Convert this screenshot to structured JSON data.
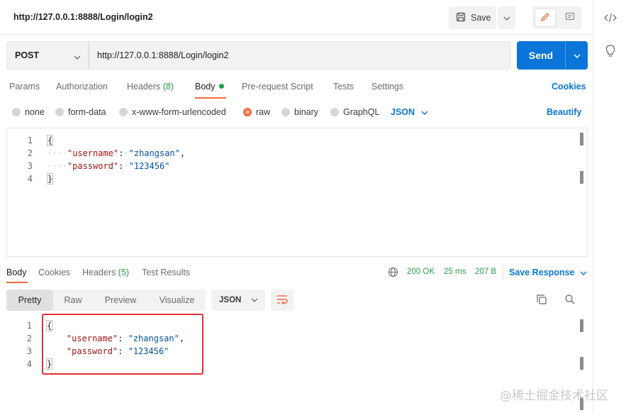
{
  "header": {
    "title": "http://127.0.0.1:8888/Login/login2",
    "save_label": "Save"
  },
  "request": {
    "method": "POST",
    "url": "http://127.0.0.1:8888/Login/login2",
    "send_label": "Send"
  },
  "request_tabs": [
    {
      "label": "Params"
    },
    {
      "label": "Authorization"
    },
    {
      "label": "Headers",
      "count": "(8)"
    },
    {
      "label": "Body"
    },
    {
      "label": "Pre-request Script"
    },
    {
      "label": "Tests"
    },
    {
      "label": "Settings"
    }
  ],
  "cookies_label": "Cookies",
  "body_types": [
    "none",
    "form-data",
    "x-www-form-urlencoded",
    "raw",
    "binary",
    "GraphQL"
  ],
  "body_type_selected": "raw",
  "body_format": "JSON",
  "beautify_label": "Beautify",
  "request_body": {
    "line_numbers": [
      "1",
      "2",
      "3",
      "4"
    ],
    "open": "{",
    "close": "}",
    "key1": "\"username\"",
    "val1": "\"zhangsan\"",
    "key2": "\"password\"",
    "val2": "\"123456\""
  },
  "response_tabs": [
    {
      "label": "Body"
    },
    {
      "label": "Cookies"
    },
    {
      "label": "Headers",
      "count": "(5)"
    },
    {
      "label": "Test Results"
    }
  ],
  "response_status": {
    "code": "200 OK",
    "time": "25 ms",
    "size": "207 B",
    "save_response_label": "Save Response"
  },
  "view_modes": [
    "Pretty",
    "Raw",
    "Preview",
    "Visualize"
  ],
  "response_format": "JSON",
  "response_body": {
    "line_numbers": [
      "1",
      "2",
      "3",
      "4"
    ],
    "open": "{",
    "close": "}",
    "key1": "\"username\"",
    "val1": "\"zhangsan\"",
    "key2": "\"password\"",
    "val2": "\"123456\""
  },
  "watermark": "@稀土掘金技术社区",
  "colors": {
    "accent_blue": "#0b75d8",
    "active_orange": "#f26b3a",
    "status_green": "#2a9d4a",
    "highlight_red": "#e03131"
  }
}
